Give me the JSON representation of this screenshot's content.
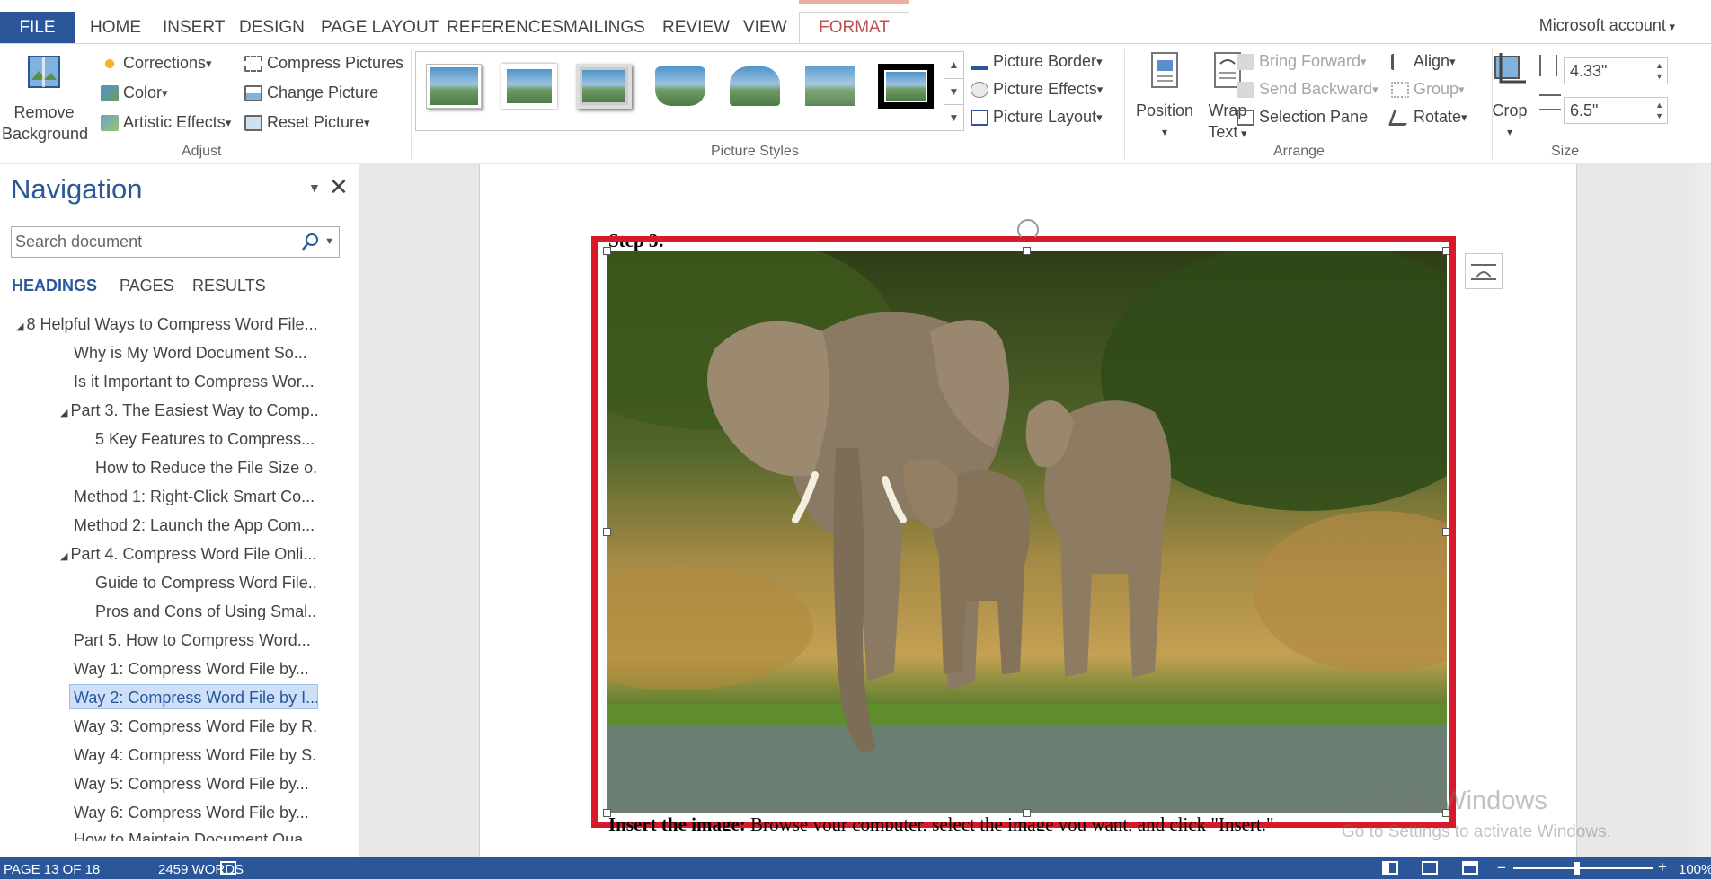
{
  "tabs": {
    "file": "FILE",
    "home": "HOME",
    "insert": "INSERT",
    "design": "DESIGN",
    "page_layout": "PAGE LAYOUT",
    "references": "REFERENCES",
    "mailings": "MAILINGS",
    "review": "REVIEW",
    "view": "VIEW",
    "format": "FORMAT"
  },
  "account": "Microsoft account",
  "ribbon": {
    "adjust": {
      "remove_bg_1": "Remove",
      "remove_bg_2": "Background",
      "corrections": "Corrections",
      "color": "Color",
      "artistic": "Artistic Effects",
      "compress": "Compress Pictures",
      "change": "Change Picture",
      "reset": "Reset Picture",
      "label": "Adjust"
    },
    "styles": {
      "label": "Picture Styles",
      "border": "Picture Border",
      "effects": "Picture Effects",
      "layout": "Picture Layout"
    },
    "arrange": {
      "position": "Position",
      "wrap_1": "Wrap",
      "wrap_2": "Text",
      "bring_forward": "Bring Forward",
      "send_backward": "Send Backward",
      "selection_pane": "Selection Pane",
      "align": "Align",
      "group": "Group",
      "rotate": "Rotate",
      "label": "Arrange"
    },
    "size": {
      "crop": "Crop",
      "height": "4.33\"",
      "width": "6.5\"",
      "label": "Size"
    }
  },
  "nav": {
    "title": "Navigation",
    "search_placeholder": "Search document",
    "tabs": [
      "HEADINGS",
      "PAGES",
      "RESULTS"
    ],
    "items": [
      "8 Helpful Ways to Compress Word File...",
      "Why is My Word Document So...",
      "Is it Important to Compress Wor...",
      "Part 3. The Easiest Way to Comp...",
      "5 Key Features to Compress...",
      "How to Reduce the File Size o...",
      "Method 1: Right-Click Smart Co...",
      "Method 2: Launch the App Com...",
      "Part 4. Compress Word File Onli...",
      "Guide to Compress Word File...",
      "Pros and Cons of Using Smal...",
      "Part 5. How to Compress Word...",
      "Way 1: Compress Word File by...",
      "Way 2: Compress Word File by I...",
      "Way 3: Compress Word File by R...",
      "Way 4: Compress Word File by S...",
      "Way 5: Compress Word File by...",
      "Way 6: Compress Word File by...",
      "How to Maintain Document Qua..."
    ]
  },
  "doc": {
    "step_label": "Step 3:",
    "caption_bold": "Insert the image:",
    "caption_rest": " Browse your computer, select the image you want, and click \"Insert.\""
  },
  "watermark": {
    "line1": "Activate Windows",
    "line2": "Go to Settings to activate Windows."
  },
  "status": {
    "page": "PAGE 13 OF 18",
    "words": "2459 WORDS",
    "zoom": "100%"
  },
  "colors": {
    "accent": "#2b579a",
    "format_tab": "#c0504d",
    "selection_frame": "#d7192a"
  }
}
